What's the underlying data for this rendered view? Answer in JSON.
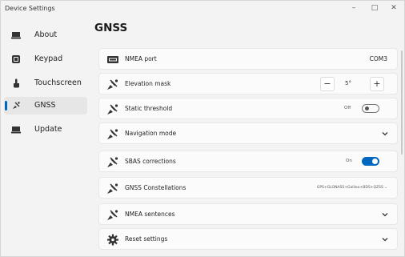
{
  "window": {
    "title": "Device Settings",
    "minimize_glyph": "–",
    "maximize_glyph": "□",
    "close_glyph": "✕"
  },
  "sidebar": {
    "items": [
      {
        "label": "About",
        "icon": "laptop-icon",
        "active": false
      },
      {
        "label": "Keypad",
        "icon": "keypad-icon",
        "active": false
      },
      {
        "label": "Touchscreen",
        "icon": "touch-hand-icon",
        "active": false
      },
      {
        "label": "GNSS",
        "icon": "satellite-icon",
        "active": true
      },
      {
        "label": "Update",
        "icon": "laptop-icon",
        "active": false
      }
    ]
  },
  "page": {
    "title": "GNSS"
  },
  "settings": {
    "nmea_port": {
      "label": "NMEA port",
      "value": "COM3",
      "icon": "port-icon"
    },
    "elevation_mask": {
      "label": "Elevation mask",
      "value": "5°",
      "minus": "−",
      "plus": "+",
      "icon": "satellite-icon"
    },
    "static_threshold": {
      "label": "Static threshold",
      "state_label": "Off",
      "on": false,
      "icon": "satellite-icon"
    },
    "navigation_mode": {
      "label": "Navigation mode",
      "icon": "satellite-icon"
    },
    "sbas_corrections": {
      "label": "SBAS corrections",
      "state_label": "On",
      "on": true,
      "icon": "satellite-icon"
    },
    "gnss_constellations": {
      "label": "GNSS Constellations",
      "value": "GPS+GLONASS+Galileo+BDS+QZSS",
      "icon": "satellite-icon"
    },
    "nmea_sentences": {
      "label": "NMEA sentences",
      "icon": "satellite-icon"
    },
    "reset_settings": {
      "label": "Reset settings",
      "icon": "gear-icon"
    }
  },
  "colors": {
    "accent": "#0067c0",
    "background": "#f3f3f3",
    "card": "#fbfbfb"
  }
}
